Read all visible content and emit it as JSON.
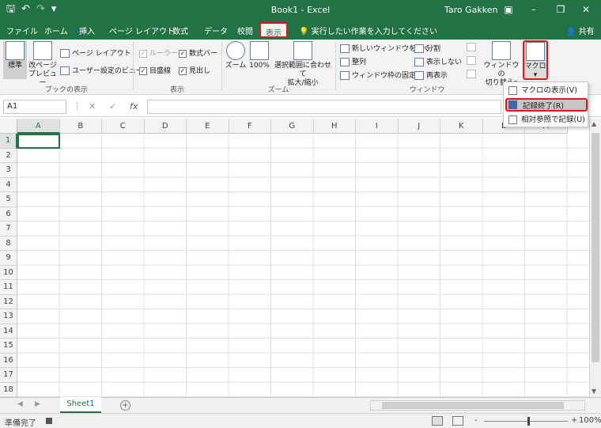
{
  "titlebar": {
    "title": "Book1 - Excel",
    "user": "Taro Gakken",
    "qat": [
      "save-icon",
      "undo-icon",
      "redo-icon",
      "customize-icon"
    ],
    "window_buttons": [
      "ribbon-options-icon",
      "minimize-icon",
      "restore-icon",
      "close-icon"
    ],
    "bg": "#217346"
  },
  "tabs": [
    {
      "label": "ファイル"
    },
    {
      "label": "ホーム"
    },
    {
      "label": "挿入"
    },
    {
      "label": "ページ レイアウト"
    },
    {
      "label": "数式"
    },
    {
      "label": "データ"
    },
    {
      "label": "校閲"
    },
    {
      "label": "表示",
      "active": true
    }
  ],
  "tellme": "実行したい作業を入力してください",
  "share": "共有",
  "ribbon": {
    "book_views": {
      "label": "ブックの表示",
      "normal": "標準",
      "pagebreak_line1": "改ページ",
      "pagebreak_line2": "プレビュー",
      "page_layout": "ページ レイアウト",
      "custom_views": "ユーザー設定のビュー"
    },
    "show": {
      "label": "表示",
      "ruler": "ルーラー",
      "formula_bar": "数式バー",
      "gridlines": "目盛線",
      "headings": "見出し"
    },
    "zoom": {
      "label": "ズーム",
      "zoom": "ズーム",
      "zoom100": "100%",
      "zoom_sel_line1": "選択範囲に合わせて",
      "zoom_sel_line2": "拡大/縮小"
    },
    "window": {
      "label": "ウィンドウ",
      "new_window": "新しいウィンドウを開く",
      "arrange": "整列",
      "freeze": "ウィンドウ枠の固定",
      "split": "分割",
      "hide": "表示しない",
      "unhide": "再表示",
      "switch_line1": "ウィンドウの",
      "switch_line2": "切り替え"
    },
    "macro": {
      "label": "マクロ"
    }
  },
  "macro_menu": {
    "view": "マクロの表示(V)",
    "stop": "記録終了(R)",
    "relative": "相対参照で記録(U)"
  },
  "formula": {
    "name_box": "A1",
    "fx": "fx"
  },
  "grid": {
    "columns": [
      "A",
      "B",
      "C",
      "D",
      "E",
      "F",
      "G",
      "H",
      "I",
      "J",
      "K",
      "L",
      "M"
    ],
    "rows": [
      "1",
      "2",
      "3",
      "4",
      "5",
      "6",
      "7",
      "8",
      "9",
      "10",
      "11",
      "12",
      "13",
      "14",
      "15",
      "16",
      "17",
      "18"
    ],
    "active_cell": "A1"
  },
  "sheets": [
    {
      "name": "Sheet1",
      "active": true
    }
  ],
  "status": {
    "ready": "準備完了",
    "zoom": "100%",
    "minus": "-",
    "plus": "+"
  },
  "colors": {
    "accent": "#217346",
    "highlight": "#e3141c"
  }
}
